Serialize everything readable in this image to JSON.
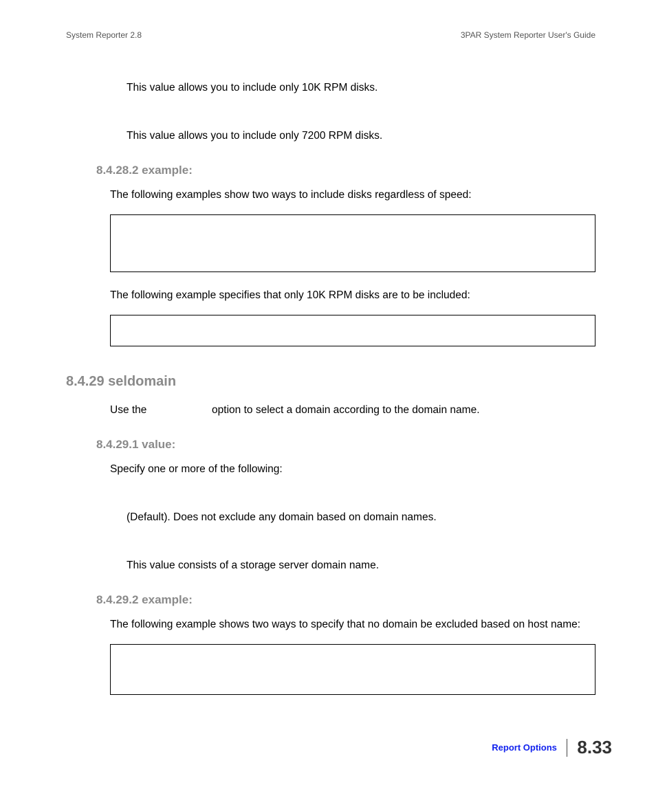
{
  "header": {
    "left": "System Reporter 2.8",
    "right": "3PAR System Reporter User's Guide"
  },
  "paragraphs": {
    "p1": "This value allows you to include only 10K RPM disks.",
    "p2": "This value allows you to include only 7200 RPM disks.",
    "p3": "The following examples show two ways to include disks regardless of speed:",
    "p4": "The following example specifies that only 10K RPM disks are to be included:",
    "p5a": "Use the",
    "p5b": "option to select a domain according to the domain name.",
    "p6": "Specify one or more of the following:",
    "p7": "(Default). Does not exclude any domain based on domain names.",
    "p8": "This value consists of a storage server domain name.",
    "p9": "The following example shows two ways to specify that no domain be excluded based on host name:"
  },
  "headings": {
    "h1": "8.4.28.2 example:",
    "h2": "8.4.29 seldomain",
    "h3": "8.4.29.1 value:",
    "h4": "8.4.29.2 example:"
  },
  "footer": {
    "link": "Report Options",
    "page": "8.33"
  }
}
